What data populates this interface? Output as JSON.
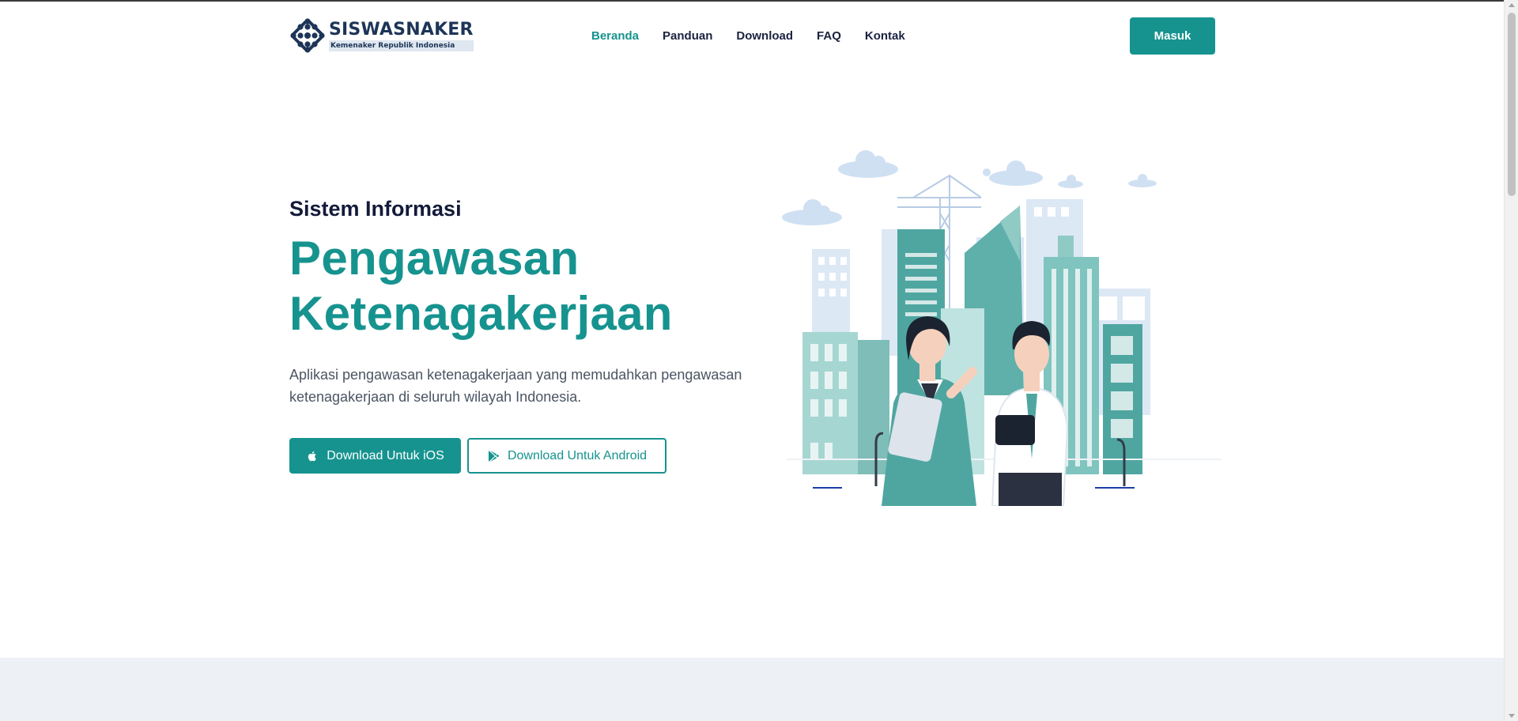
{
  "header": {
    "logo": {
      "title": "SISWASNAKER",
      "subtitle": "Kemenaker Republik Indonesia",
      "icon": "ministry-logo-icon"
    },
    "nav": [
      {
        "label": "Beranda",
        "active": true
      },
      {
        "label": "Panduan",
        "active": false
      },
      {
        "label": "Download",
        "active": false
      },
      {
        "label": "FAQ",
        "active": false
      },
      {
        "label": "Kontak",
        "active": false
      }
    ],
    "login_label": "Masuk"
  },
  "hero": {
    "kicker": "Sistem Informasi",
    "headline_line1": "Pengawasan",
    "headline_line2": "Ketenagakerjaan",
    "description": "Aplikasi pengawasan ketenagakerjaan yang memudahkan pengawasan ketenagakerjaan di seluruh wilayah Indonesia.",
    "ios_button": {
      "label": "Download Untuk iOS",
      "icon": "apple-icon"
    },
    "android_button": {
      "label": "Download Untuk Android",
      "icon": "play-store-icon"
    },
    "illustration": "city-business-people-illustration"
  },
  "colors": {
    "accent": "#16938f",
    "navy": "#1a2340",
    "band": "#edf0f4"
  }
}
